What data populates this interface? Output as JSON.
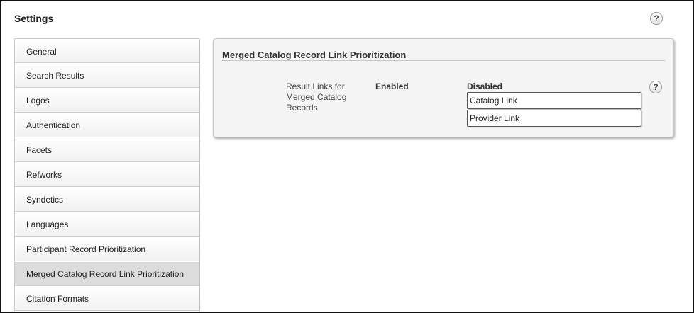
{
  "header": {
    "title": "Settings",
    "help_icon": "?"
  },
  "sidebar": {
    "items": [
      {
        "label": "General"
      },
      {
        "label": "Search Results"
      },
      {
        "label": "Logos"
      },
      {
        "label": "Authentication"
      },
      {
        "label": "Facets"
      },
      {
        "label": "Refworks"
      },
      {
        "label": "Syndetics"
      },
      {
        "label": "Languages"
      },
      {
        "label": "Participant Record Prioritization"
      },
      {
        "label": "Merged Catalog Record Link Prioritization"
      },
      {
        "label": "Citation Formats"
      }
    ],
    "active_index": 9
  },
  "panel": {
    "title": "Merged Catalog Record Link Prioritization",
    "field_label": "Result Links for Merged Catalog Records",
    "enabled_heading": "Enabled",
    "disabled_heading": "Disabled",
    "disabled_items": [
      "Catalog Link",
      "Provider Link"
    ],
    "help_icon": "?"
  }
}
